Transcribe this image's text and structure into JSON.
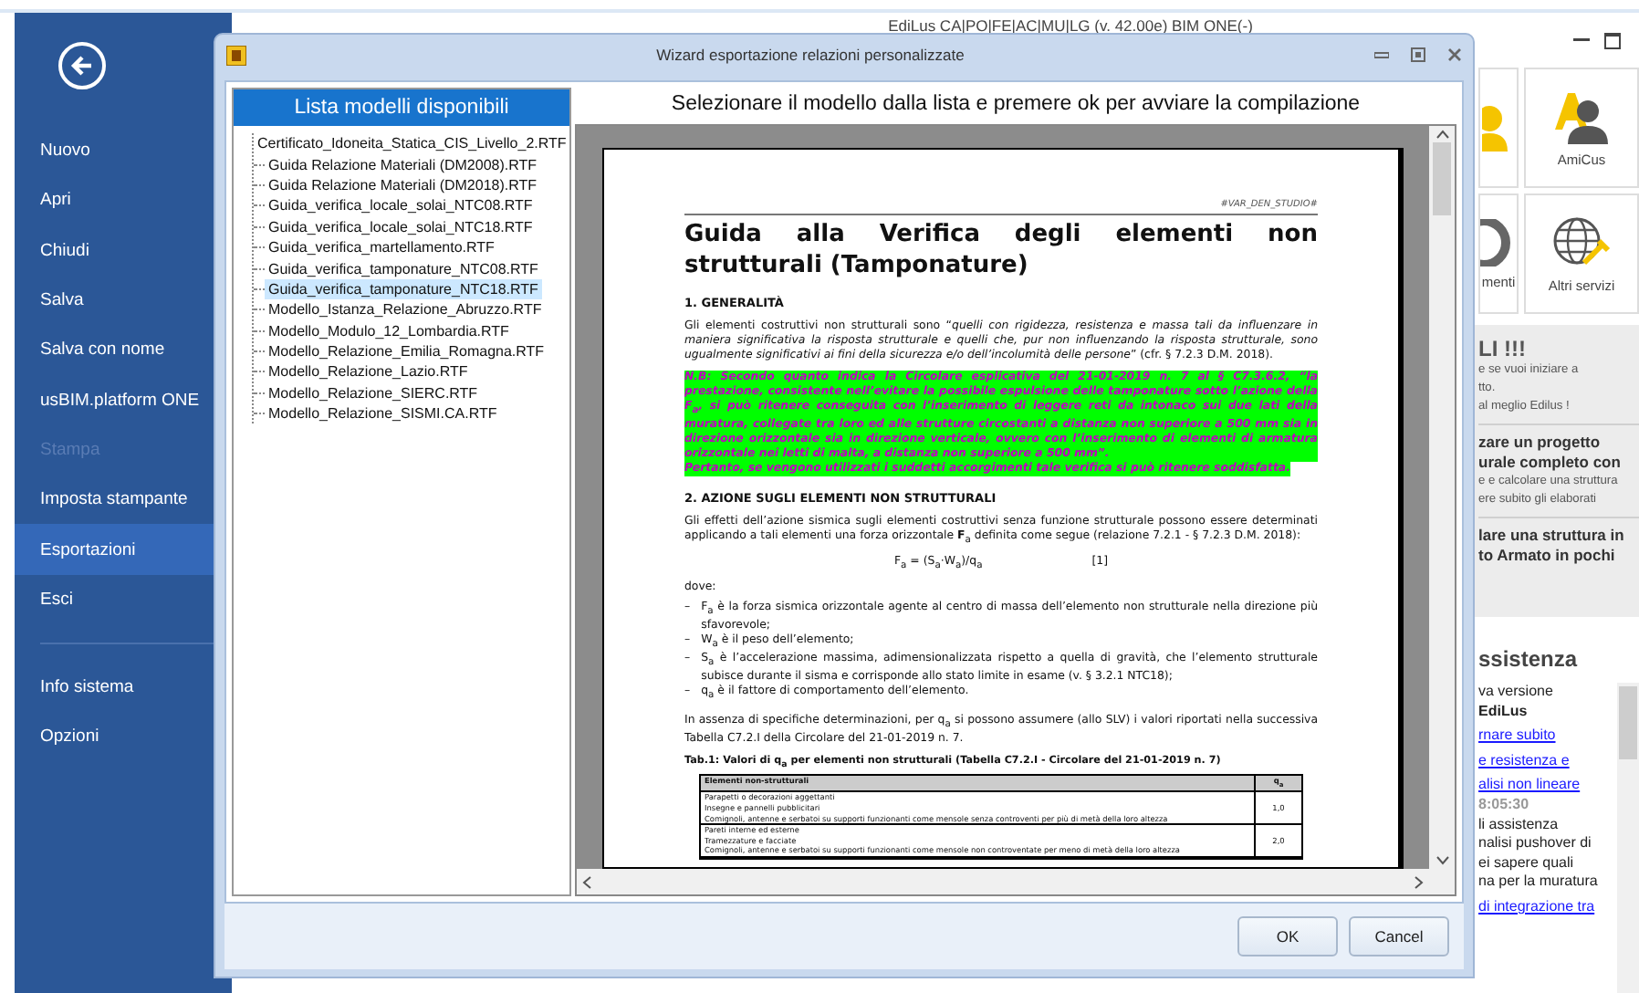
{
  "main_window": {
    "title": "EdiLus CA|PO|FE|AC|MU|LG (v. 42.00e) BIM ONE(-)"
  },
  "sidebar": {
    "groups": [
      {
        "items": [
          {
            "label": "Nuovo",
            "selected": false,
            "disabled": false
          },
          {
            "label": "Apri",
            "selected": false,
            "disabled": false
          },
          {
            "label": "Chiudi",
            "selected": false,
            "disabled": false
          },
          {
            "label": "Salva",
            "selected": false,
            "disabled": false
          },
          {
            "label": "Salva con nome",
            "selected": false,
            "disabled": false
          },
          {
            "label": "usBIM.platform ONE",
            "selected": false,
            "disabled": false
          },
          {
            "label": "Stampa",
            "selected": false,
            "disabled": true
          },
          {
            "label": "Imposta stampante",
            "selected": false,
            "disabled": false
          },
          {
            "label": "Esportazioni",
            "selected": true,
            "disabled": false
          },
          {
            "label": "Esci",
            "selected": false,
            "disabled": false
          }
        ]
      },
      {
        "items": [
          {
            "label": "Info sistema",
            "selected": false,
            "disabled": false
          },
          {
            "label": "Opzioni",
            "selected": false,
            "disabled": false
          }
        ]
      }
    ]
  },
  "tiles": [
    {
      "label": "menti",
      "kind": "gear"
    },
    {
      "label": "Altri servizi",
      "kind": "globe"
    }
  ],
  "amicus_tile": {
    "label": "AmiCus"
  },
  "promo": {
    "heading": "LI !!!",
    "lines": [
      "e se vuoi iniziare a",
      "tto.",
      "al meglio Edilus !"
    ],
    "items": [
      {
        "title": [
          "zare un progetto",
          "urale completo con"
        ],
        "lines": [
          "e e calcolare una struttura",
          "ere subito gli elaborati"
        ]
      },
      {
        "title": [
          "lare una struttura in",
          "to Armato in pochi"
        ]
      }
    ]
  },
  "assistance": {
    "heading": "ssistenza",
    "news": [
      {
        "kind": "text",
        "text": "va versione"
      },
      {
        "kind": "bold",
        "text": "EdiLus"
      },
      {
        "kind": "link",
        "text": "rnare subito"
      },
      {
        "kind": "link",
        "text": "e resistenza e"
      },
      {
        "kind": "link",
        "text": "alisi non lineare"
      },
      {
        "kind": "time",
        "text": "8:05:30"
      },
      {
        "kind": "text",
        "text": "li assistenza"
      },
      {
        "kind": "text",
        "text": "nalisi pushover di"
      },
      {
        "kind": "text",
        "text": "ei sapere quali"
      },
      {
        "kind": "text",
        "text": "na per la muratura"
      },
      {
        "kind": "link",
        "text": "di integrazione tra"
      }
    ]
  },
  "dialog": {
    "title": "Wizard esportazione relazioni personalizzate",
    "list_header": "Lista modelli disponibili",
    "instruction": "Selezionare il modello dalla lista e premere ok per avviare la compilazione",
    "templates": [
      {
        "name": "Certificato_Idoneita_Statica_CIS_Livello_2.RTF",
        "selected": false
      },
      {
        "name": "Guida Relazione Materiali (DM2008).RTF",
        "selected": false
      },
      {
        "name": "Guida Relazione Materiali (DM2018).RTF",
        "selected": false
      },
      {
        "name": "Guida_verifica_locale_solai_NTC08.RTF",
        "selected": false
      },
      {
        "name": "Guida_verifica_locale_solai_NTC18.RTF",
        "selected": false
      },
      {
        "name": "Guida_verifica_martellamento.RTF",
        "selected": false
      },
      {
        "name": "Guida_verifica_tamponature_NTC08.RTF",
        "selected": false
      },
      {
        "name": "Guida_verifica_tamponature_NTC18.RTF",
        "selected": true
      },
      {
        "name": "Modello_Istanza_Relazione_Abruzzo.RTF",
        "selected": false
      },
      {
        "name": "Modello_Modulo_12_Lombardia.RTF",
        "selected": false
      },
      {
        "name": "Modello_Relazione_Emilia_Romagna.RTF",
        "selected": false
      },
      {
        "name": "Modello_Relazione_Lazio.RTF",
        "selected": false
      },
      {
        "name": "Modello_Relazione_SIERC.RTF",
        "selected": false
      },
      {
        "name": "Modello_Relazione_SISMI.CA.RTF",
        "selected": false
      }
    ],
    "buttons": [
      "OK",
      "Cancel"
    ]
  },
  "document": {
    "header": "#VAR_DEN_STUDIO#",
    "title": "Guida alla Verifica degli elementi non strutturali (Tamponature)",
    "section_1": "1. GENERALITÀ",
    "paragraph_1": "Gli elementi costruttivi non strutturali sono “*quelli con rigidezza, resistenza e massa tali da influenzare in maniera significativa la risposta strutturale e quelli che, pur non influenzando la risposta strutturale, sono ugualmente significativi ai fini della sicurezza e/o dell’incolumità delle persone*” (cfr. § 7.2.3 D.M. 2018).",
    "note": [
      "N.B: Secondo quanto indica la Circolare esplicativa del 21-01-2019 n. 7 al § C7.3.6.2, “la prestazione, consistente nell’evitare la possibile espulsione delle tamponature sotto l’azione della F$_{a}$, si può ritenere conseguita con l’inserimento di leggere reti da intonaco sui due lati della muratura, collegate tra loro ed alle strutture circostanti a distanza non superiore a 500 mm sia in direzione orizzontale sia in direzione verticale, ovvero con l’inserimento di elementi di armatura orizzontale nei letti di malta, a distanza non superiore a 500 mm”.",
      "Pertanto, se vengono utilizzati i suddetti accorgimenti tale verifica si può ritenere soddisfatta."
    ],
    "section_2": "2. AZIONE SUGLI ELEMENTI NON STRUTTURALI",
    "paragraph_2": "Gli effetti dell’azione sismica sugli elementi costruttivi senza funzione strutturale possono essere determinati applicando a tali elementi una forza orizzontale **F**$_{a}$ definita come segue (relazione 7.2.1 - § 7.2.3 D.M. 2018):",
    "formula": "F$_{a}$ = (S$_{a}$·W$_{a}$)/q$_{a}$",
    "formula_number": "[1]",
    "where": "dove:",
    "bullets": [
      {
        "marker": "–",
        "text": "F$_{a}$ è la forza sismica orizzontale agente al centro di massa dell’elemento non strutturale nella direzione più sfavorevole;"
      },
      {
        "marker": "–",
        "text": "W$_{a}$ è il peso dell’elemento;"
      },
      {
        "marker": "–",
        "text": "S$_{a}$ è l’accelerazione massima, adimensionalizzata rispetto a quella di gravità, che l’elemento strutturale subisce durante il sisma e corrisponde allo stato limite in esame (v. § 3.2.1 NTC18);"
      },
      {
        "marker": "–",
        "text": "q$_{a}$ è il fattore di comportamento dell’elemento."
      }
    ],
    "paragraph_3": "In assenza di specifiche determinazioni, per q$_{a}$ si possono assumere (allo SLV) i valori riportati nella successiva Tabella C7.2.I della Circolare del 21-01-2019 n. 7.",
    "table_caption": "Tab.1: Valori di q$_{a}$ per elementi non strutturali (Tabella C7.2.I - Circolare del 21-01-2019 n. 7)",
    "table": {
      "columns": [
        "Elementi non-strutturali",
        "q$_{a}$"
      ],
      "rows": [
        {
          "lines": [
            "Parapetti o decorazioni aggettanti",
            "Insegne e pannelli pubblicitari",
            "Comignoli, antenne e serbatoi su supporti funzionanti come mensole senza controventi per più di metà della loro altezza"
          ],
          "value": "1,0"
        },
        {
          "lines": [
            "Pareti interne ed esterne",
            "Tramezzature e facciate",
            "Comignoli, antenne e serbatoi su supporti funzionanti come mensole non controventate per meno di metà della loro altezza"
          ],
          "value": "2,0"
        }
      ]
    }
  }
}
